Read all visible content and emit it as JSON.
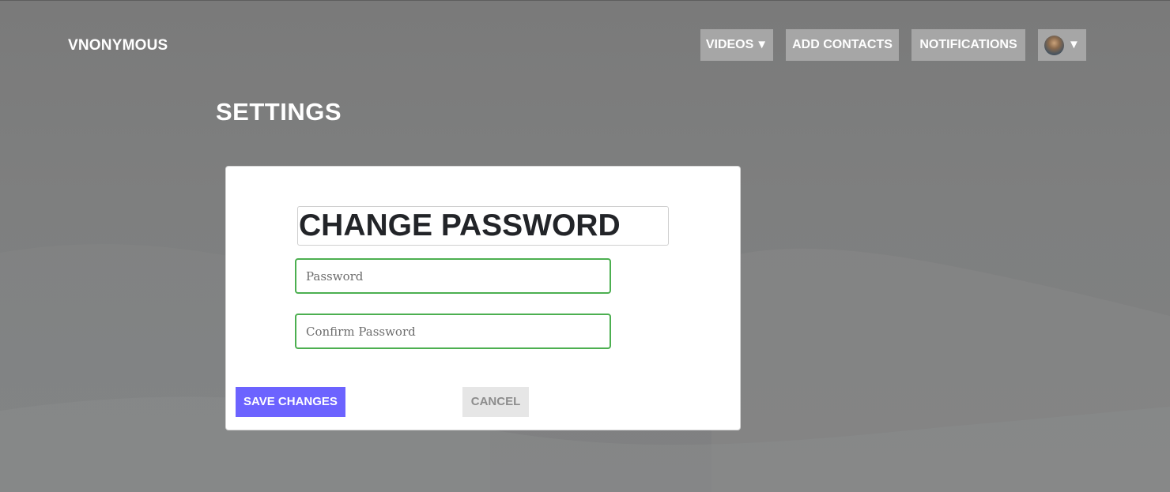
{
  "header": {
    "brand": "VNONYMOUS",
    "nav": {
      "videos_label": "VIDEOS",
      "videos_caret": "▼",
      "add_contacts_label": "ADD CONTACTS",
      "notifications_label": "NOTIFICATIONS",
      "profile_caret": "▼"
    }
  },
  "page": {
    "title": "SETTINGS"
  },
  "change_password": {
    "heading": "CHANGE PASSWORD",
    "password_field": {
      "value": "",
      "placeholder": "Password"
    },
    "confirm_field": {
      "value": "",
      "placeholder": "Confirm Password"
    },
    "save_label": "SAVE CHANGES",
    "cancel_label": "CANCEL"
  },
  "colors": {
    "accent": "#6c63ff",
    "field_border": "#4caf50",
    "nav_button_bg": "#a6a6a6",
    "cancel_bg": "#e6e6e6"
  },
  "icons": {
    "dropdown": "chevron-down-icon",
    "avatar": "user-avatar"
  }
}
